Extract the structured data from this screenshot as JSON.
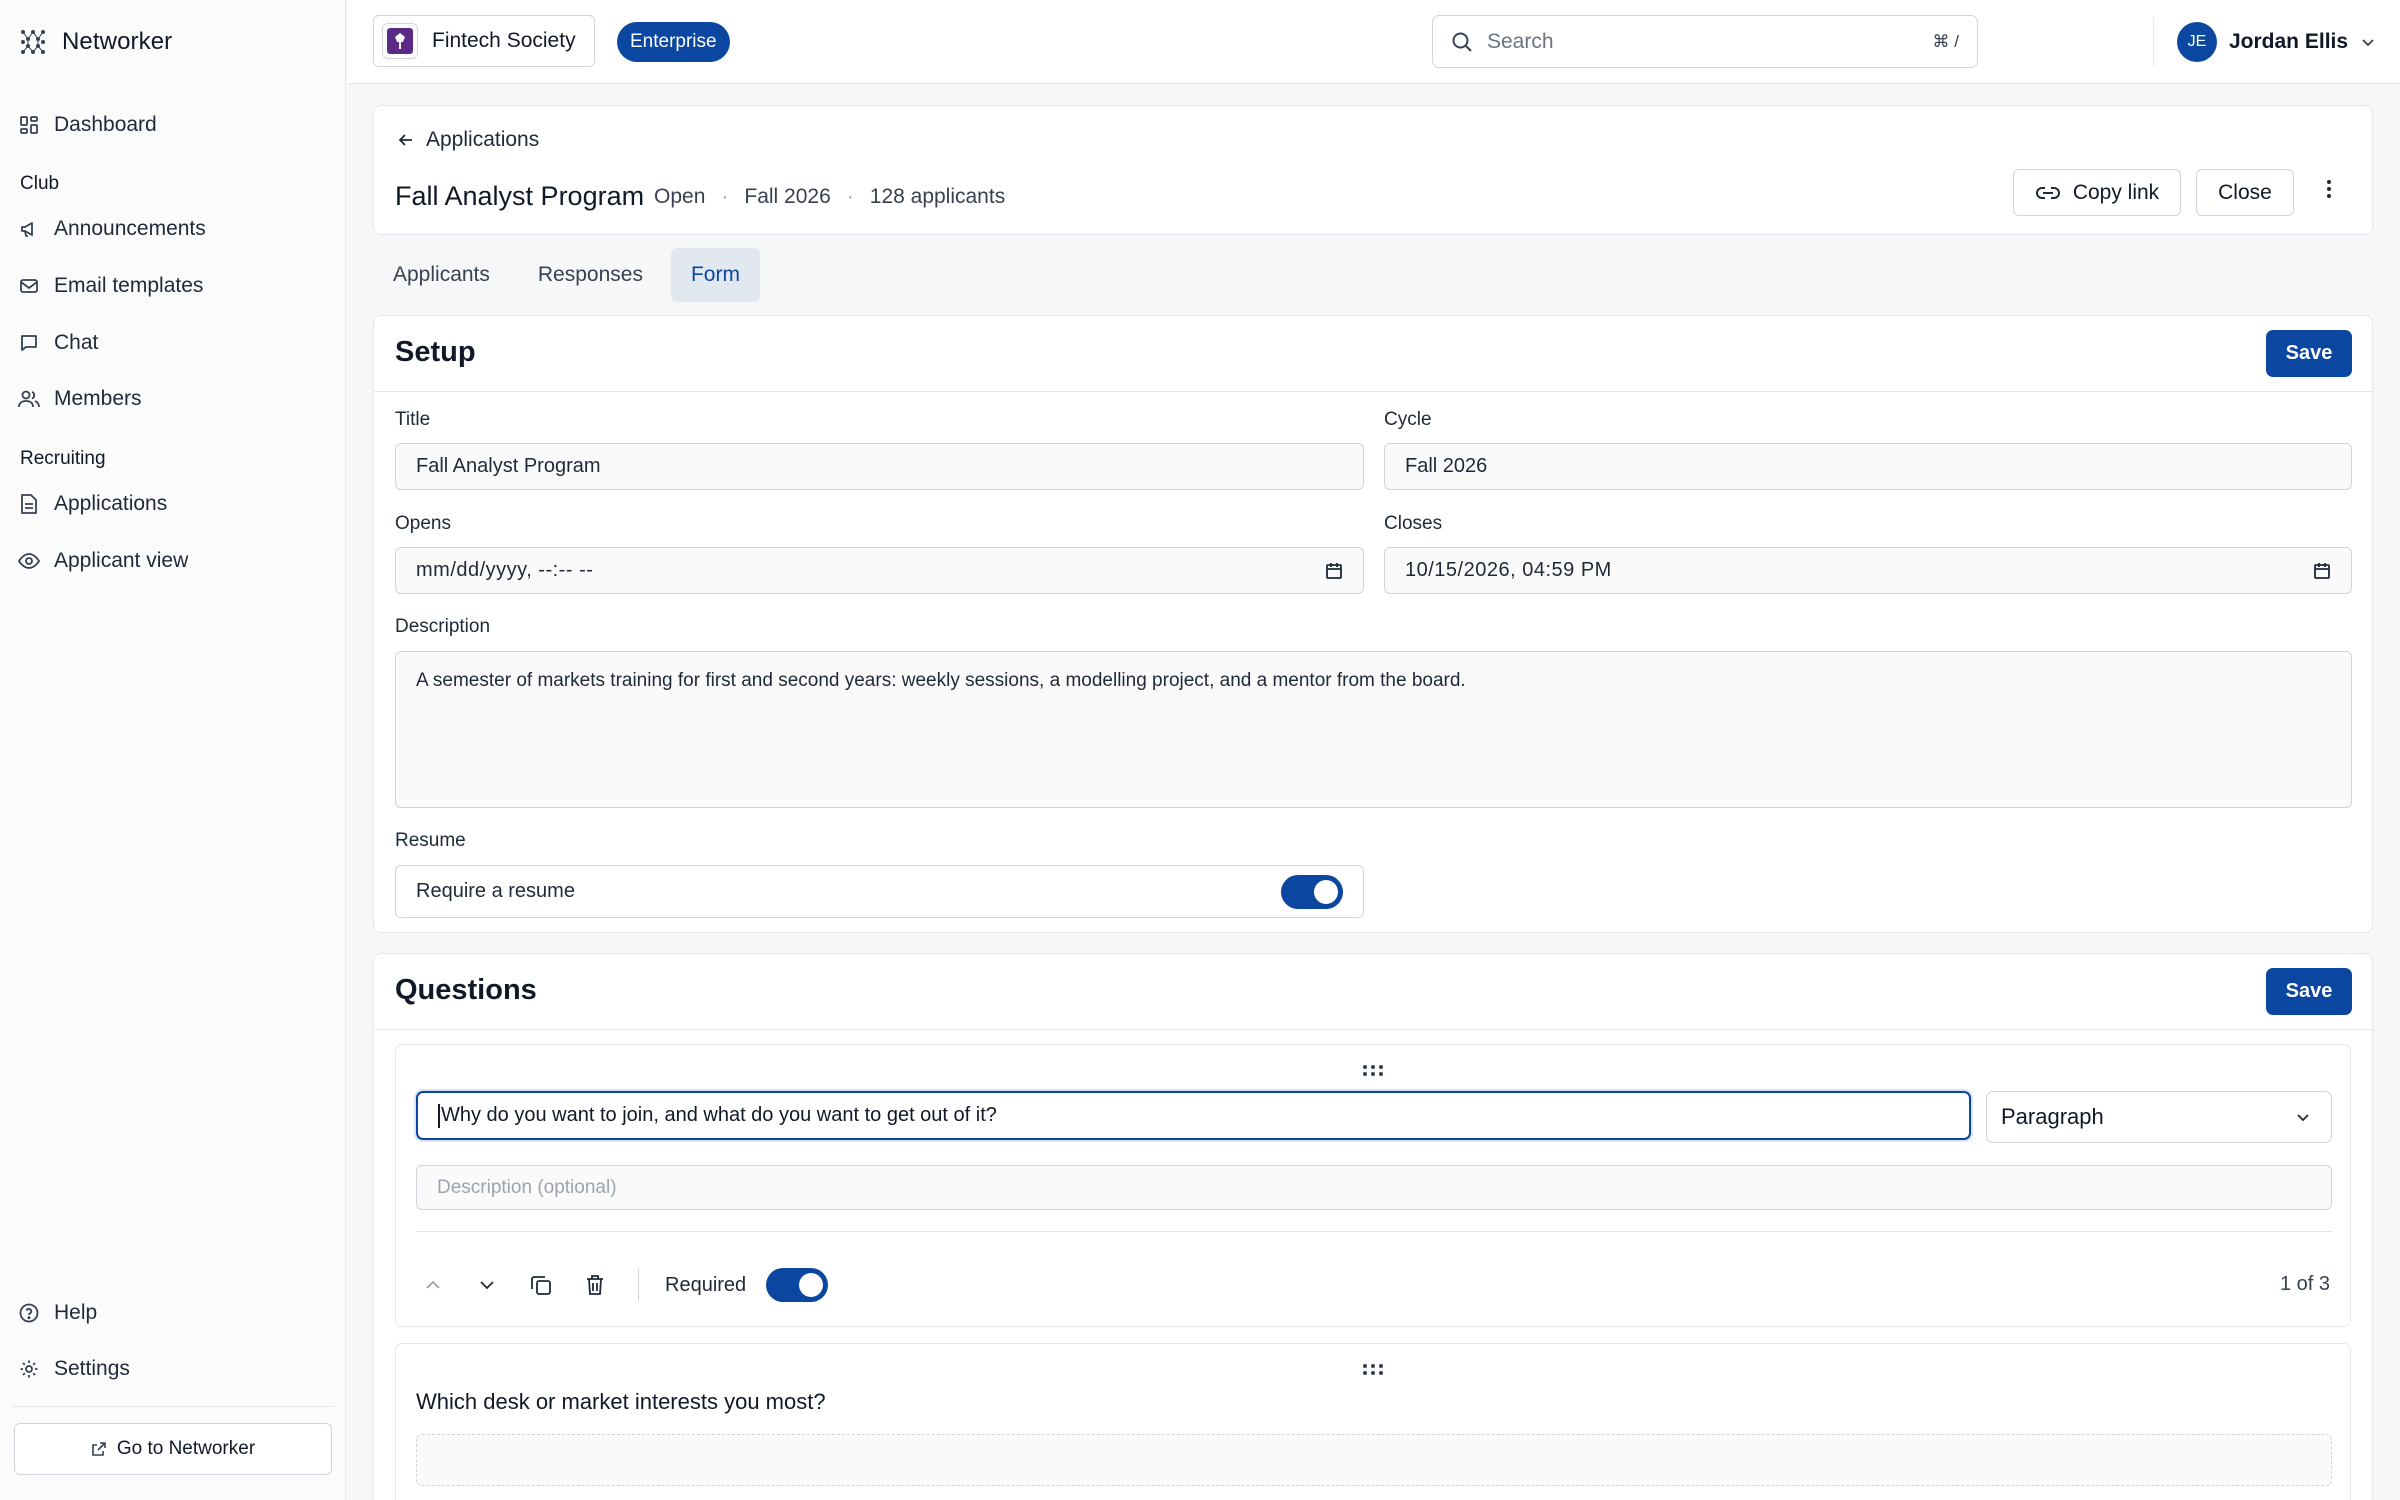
{
  "app": {
    "name": "Networker"
  },
  "sidebar": {
    "top_items": [
      {
        "label": "Dashboard",
        "icon": "dashboard-icon"
      }
    ],
    "club_section": "Club",
    "club_items": [
      {
        "label": "Announcements",
        "icon": "megaphone-icon"
      },
      {
        "label": "Email templates",
        "icon": "mail-icon"
      },
      {
        "label": "Chat",
        "icon": "chat-icon"
      },
      {
        "label": "Members",
        "icon": "users-icon"
      }
    ],
    "recruiting_section": "Recruiting",
    "recruiting_items": [
      {
        "label": "Applications",
        "icon": "document-icon"
      },
      {
        "label": "Applicant view",
        "icon": "eye-icon"
      }
    ],
    "bottom_items": [
      {
        "label": "Help",
        "icon": "help-icon"
      },
      {
        "label": "Settings",
        "icon": "gear-icon"
      }
    ],
    "goto_label": "Go to Networker"
  },
  "topbar": {
    "org_name": "Fintech Society",
    "plan_badge": "Enterprise",
    "search_placeholder": "Search",
    "search_shortcut": "⌘ /",
    "user_initials": "JE",
    "user_name": "Jordan Ellis"
  },
  "header": {
    "back_label": "Applications",
    "title": "Fall Analyst Program",
    "status": "Open",
    "cycle": "Fall 2026",
    "applicants": "128 applicants",
    "copy_link_label": "Copy link",
    "close_label": "Close"
  },
  "tabs": [
    {
      "label": "Applicants",
      "active": false
    },
    {
      "label": "Responses",
      "active": false
    },
    {
      "label": "Form",
      "active": true
    }
  ],
  "setup": {
    "title": "Setup",
    "save_label": "Save",
    "title_label": "Title",
    "title_value": "Fall Analyst Program",
    "cycle_label": "Cycle",
    "cycle_value": "Fall 2026",
    "opens_label": "Opens",
    "opens_value": "mm/dd/yyyy, --:-- --",
    "closes_label": "Closes",
    "closes_value": "10/15/2026, 04:59 PM",
    "description_label": "Description",
    "description_value": "A semester of markets training for first and second years: weekly sessions, a modelling project, and a mentor from the board.",
    "resume_label": "Resume",
    "resume_toggle_label": "Require a resume",
    "resume_required": true
  },
  "questions": {
    "title": "Questions",
    "save_label": "Save",
    "items": [
      {
        "prompt": "Why do you want to join, and what do you want to get out of it?",
        "type": "Paragraph",
        "description_placeholder": "Description (optional)",
        "required_label": "Required",
        "required": true,
        "position": "1 of 3"
      },
      {
        "prompt": "Which desk or market interests you most?"
      }
    ]
  },
  "colors": {
    "accent": "#0b46a0",
    "org_logo": "#5b2a86"
  }
}
